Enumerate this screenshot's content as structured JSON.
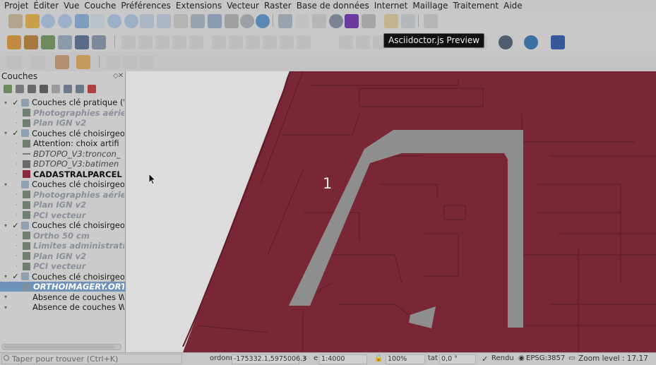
{
  "menu": [
    "Projet",
    "Éditer",
    "Vue",
    "Couche",
    "Préférences",
    "Extensions",
    "Vecteur",
    "Raster",
    "Base de données",
    "Internet",
    "Maillage",
    "Traitement",
    "Aide"
  ],
  "tooltip": "Asciidoctor.js Preview",
  "layers_panel": {
    "title": "Couches",
    "layers": [
      {
        "label": "Couches clé pratique (W",
        "style": "normal",
        "checked": true,
        "indent": 0,
        "icon": "group-icon"
      },
      {
        "label": "Photographies aérie",
        "style": "italic",
        "checked": false,
        "indent": 1,
        "icon": "wms-layer-icon"
      },
      {
        "label": "Plan IGN v2",
        "style": "italic",
        "checked": false,
        "indent": 1,
        "icon": "wms-layer-icon"
      },
      {
        "label": "Couches clé choisirgeop",
        "style": "normal",
        "checked": true,
        "indent": 0,
        "icon": "group-icon"
      },
      {
        "label": "Attention: choix artifi",
        "style": "normal",
        "checked": false,
        "indent": 1,
        "icon": "wms-layer-icon"
      },
      {
        "label": "BDTOPO_V3:troncon_",
        "style": "italic-dark",
        "checked": false,
        "indent": 1,
        "icon": "line-layer-icon"
      },
      {
        "label": "BDTOPO_V3:batimen",
        "style": "italic-dark",
        "checked": false,
        "indent": 1,
        "icon": "polygon-layer-icon"
      },
      {
        "label": "CADASTRALPARCEL",
        "style": "bold",
        "checked": true,
        "indent": 1,
        "icon": "polygon-layer-icon"
      },
      {
        "label": "Couches clé choisirgeop",
        "style": "normal",
        "checked": false,
        "indent": 0,
        "icon": "group-icon"
      },
      {
        "label": "Photographies aérie",
        "style": "italic",
        "checked": false,
        "indent": 1,
        "icon": "wms-layer-icon"
      },
      {
        "label": "Plan IGN v2",
        "style": "italic",
        "checked": false,
        "indent": 1,
        "icon": "wms-layer-icon"
      },
      {
        "label": "PCI vecteur",
        "style": "italic",
        "checked": false,
        "indent": 1,
        "icon": "wms-layer-icon"
      },
      {
        "label": "Couches clé choisirgeop",
        "style": "normal",
        "checked": true,
        "indent": 0,
        "icon": "group-icon"
      },
      {
        "label": "Ortho 50 cm",
        "style": "italic",
        "checked": false,
        "indent": 1,
        "icon": "wms-layer-icon"
      },
      {
        "label": "Limites administratio",
        "style": "italic",
        "checked": false,
        "indent": 1,
        "icon": "wms-layer-icon"
      },
      {
        "label": "Plan IGN v2",
        "style": "italic",
        "checked": false,
        "indent": 1,
        "icon": "wms-layer-icon"
      },
      {
        "label": "PCI vecteur",
        "style": "italic",
        "checked": false,
        "indent": 1,
        "icon": "wms-layer-icon"
      },
      {
        "label": "Couches clé choisirgeop",
        "style": "normal",
        "checked": true,
        "indent": 0,
        "icon": "group-icon"
      },
      {
        "label": "ORTHOIMAGERY.ORT",
        "style": "italic-selected",
        "checked": false,
        "indent": 1,
        "icon": "raster-layer-icon"
      },
      {
        "label": "Absence de couches WM",
        "style": "normal",
        "checked": false,
        "indent": 0,
        "icon": "none"
      },
      {
        "label": "Absence de couches WFS",
        "style": "normal",
        "checked": false,
        "indent": 0,
        "icon": "none"
      }
    ]
  },
  "map": {
    "label": "1",
    "parcel_color": "#7a2735",
    "road_color": "#8e8e8e"
  },
  "status": {
    "search_placeholder": "Taper pour trouver (Ctrl+K)",
    "coord_label": "ordonr",
    "coord_value": "-175332.1,5975006.3",
    "scale_label": "e",
    "scale_value": "1:4000",
    "zoom_value": "100%",
    "rotation_label": "tat",
    "rotation_value": "0,0 °",
    "render_label": "Rendu",
    "crs": "EPSG:3857",
    "zoom_level": "Zoom level : 17.17"
  }
}
